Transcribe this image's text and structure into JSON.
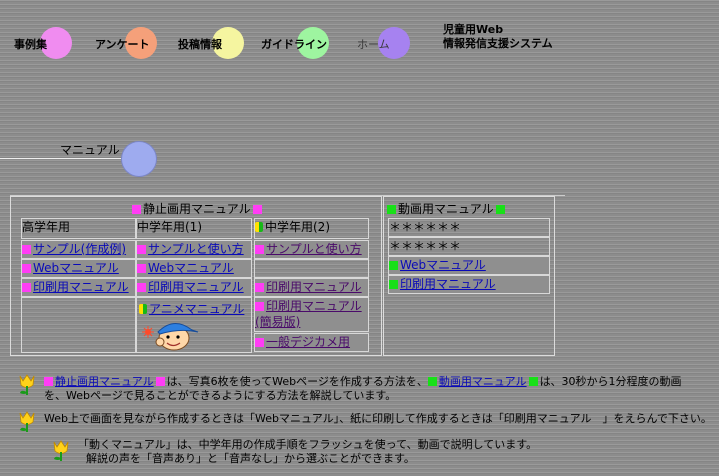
{
  "nav": {
    "items": [
      {
        "label": "事例集",
        "color": "#f08cf0"
      },
      {
        "label": "アンケート",
        "color": "#f5a07a"
      },
      {
        "label": "投稿情報",
        "color": "#f5f5a0"
      },
      {
        "label": "ガイドライン",
        "color": "#9ef5a0"
      },
      {
        "label": "ホーム",
        "color": "#a682f0"
      }
    ]
  },
  "site": {
    "title_line1": "児童用Web",
    "title_line2": "情報発信支援システム"
  },
  "section": {
    "label": "マニュアル"
  },
  "still": {
    "title": "静止画用マニュアル",
    "col1_header": "高学年用",
    "col2_header": "中学年用(1)",
    "col3_header": "中学年用(2)",
    "c1": [
      "サンプル(作成例)",
      "Webマニュアル",
      "印刷用マニュアル"
    ],
    "c2": [
      "サンプルと使い方",
      "Webマニュアル",
      "印刷用マニュアル",
      "アニメマニュアル"
    ],
    "c3": [
      "サンプルと使い方",
      "印刷用マニュアル",
      "印刷用マニュアル",
      "(簡易版)",
      "一般デジカメ用"
    ]
  },
  "video": {
    "title": "動画用マニュアル",
    "rows": [
      "＊＊＊＊＊＊",
      "＊＊＊＊＊＊",
      "Webマニュアル",
      "印刷用マニュアル"
    ]
  },
  "notes": {
    "n1_a": "静止画用マニュアル",
    "n1_b": "は、写真6枚を使ってWebページを作成する方法を、",
    "n1_c": "動画用マニュアル",
    "n1_d": "は、30秒から1分程度の動画",
    "n1_e": "を、Webページで見ることができるようにする方法を解説しています。",
    "n2": "Web上で画面を見ながら作成するときは「Webマニュアル」、紙に印刷して作成するときは「印刷用マニュアル　」をえらんで下さい。",
    "n3_a": "「動くマニュアル」は、中学年用の作成手順をフラッシュを使って、動画で説明しています。",
    "n3_b": "解説の声を「音声あり」と「音声なし」から選ぶことができます。"
  }
}
